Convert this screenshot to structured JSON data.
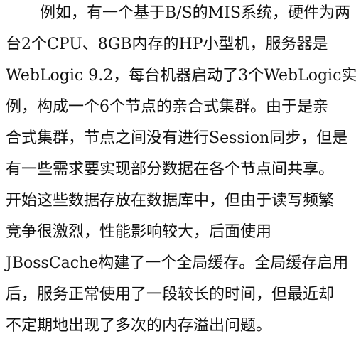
{
  "document": {
    "lines": [
      "例如，有一个基于B/S的MIS系统，硬件为两",
      "台2个CPU、8GB内存的HP小型机，服务器是",
      "WebLogic 9.2，每台机器启动了3个WebLogic实",
      "例，构成一个6个节点的亲合式集群。由于是亲",
      "合式集群，节点之间没有进行Session同步，但是",
      "有一些需求要实现部分数据在各个节点间共享。",
      "开始这些数据存放在数据库中，但由于读写频繁",
      "竞争很激烈，性能影响较大，后面使用",
      "JBossCache构建了一个全局缓存。全局缓存启用",
      "后，服务正常使用了一段较长的时间，但最近却",
      "不定期地出现了多次的内存溢出问题。"
    ]
  }
}
